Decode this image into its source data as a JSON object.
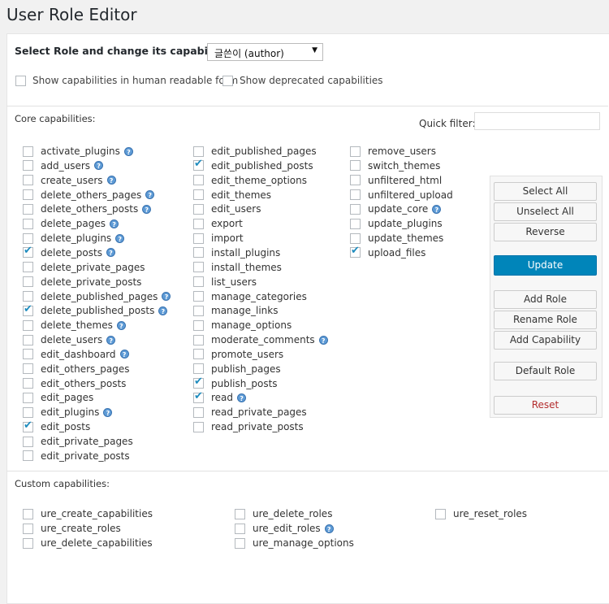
{
  "page_title": "User Role Editor",
  "role_label": "Select Role and change its capabilities:",
  "role_selected": "글쓴이 (author)",
  "options": {
    "human_readable": "Show capabilities in human readable form",
    "deprecated": "Show deprecated capabilities"
  },
  "core_label": "Core capabilities:",
  "quick_filter_label": "Quick filter:",
  "core_caps": [
    {
      "name": "activate_plugins",
      "checked": false,
      "help": true
    },
    {
      "name": "add_users",
      "checked": false,
      "help": true
    },
    {
      "name": "create_users",
      "checked": false,
      "help": true
    },
    {
      "name": "delete_others_pages",
      "checked": false,
      "help": true
    },
    {
      "name": "delete_others_posts",
      "checked": false,
      "help": true
    },
    {
      "name": "delete_pages",
      "checked": false,
      "help": true
    },
    {
      "name": "delete_plugins",
      "checked": false,
      "help": true
    },
    {
      "name": "delete_posts",
      "checked": true,
      "help": true
    },
    {
      "name": "delete_private_pages",
      "checked": false,
      "help": false
    },
    {
      "name": "delete_private_posts",
      "checked": false,
      "help": false
    },
    {
      "name": "delete_published_pages",
      "checked": false,
      "help": true
    },
    {
      "name": "delete_published_posts",
      "checked": true,
      "help": true
    },
    {
      "name": "delete_themes",
      "checked": false,
      "help": true
    },
    {
      "name": "delete_users",
      "checked": false,
      "help": true
    },
    {
      "name": "edit_dashboard",
      "checked": false,
      "help": true
    },
    {
      "name": "edit_others_pages",
      "checked": false,
      "help": false
    },
    {
      "name": "edit_others_posts",
      "checked": false,
      "help": false
    },
    {
      "name": "edit_pages",
      "checked": false,
      "help": false
    },
    {
      "name": "edit_plugins",
      "checked": false,
      "help": true
    },
    {
      "name": "edit_posts",
      "checked": true,
      "help": false
    },
    {
      "name": "edit_private_pages",
      "checked": false,
      "help": false
    },
    {
      "name": "edit_private_posts",
      "checked": false,
      "help": false
    },
    {
      "name": "edit_published_pages",
      "checked": false,
      "help": false
    },
    {
      "name": "edit_published_posts",
      "checked": true,
      "help": false
    },
    {
      "name": "edit_theme_options",
      "checked": false,
      "help": false
    },
    {
      "name": "edit_themes",
      "checked": false,
      "help": false
    },
    {
      "name": "edit_users",
      "checked": false,
      "help": false
    },
    {
      "name": "export",
      "checked": false,
      "help": false
    },
    {
      "name": "import",
      "checked": false,
      "help": false
    },
    {
      "name": "install_plugins",
      "checked": false,
      "help": false
    },
    {
      "name": "install_themes",
      "checked": false,
      "help": false
    },
    {
      "name": "list_users",
      "checked": false,
      "help": false
    },
    {
      "name": "manage_categories",
      "checked": false,
      "help": false
    },
    {
      "name": "manage_links",
      "checked": false,
      "help": false
    },
    {
      "name": "manage_options",
      "checked": false,
      "help": false
    },
    {
      "name": "moderate_comments",
      "checked": false,
      "help": true
    },
    {
      "name": "promote_users",
      "checked": false,
      "help": false
    },
    {
      "name": "publish_pages",
      "checked": false,
      "help": false
    },
    {
      "name": "publish_posts",
      "checked": true,
      "help": false
    },
    {
      "name": "read",
      "checked": true,
      "help": true
    },
    {
      "name": "read_private_pages",
      "checked": false,
      "help": false
    },
    {
      "name": "read_private_posts",
      "checked": false,
      "help": false
    },
    {
      "name": "remove_users",
      "checked": false,
      "help": false
    },
    {
      "name": "switch_themes",
      "checked": false,
      "help": false
    },
    {
      "name": "unfiltered_html",
      "checked": false,
      "help": false
    },
    {
      "name": "unfiltered_upload",
      "checked": false,
      "help": false
    },
    {
      "name": "update_core",
      "checked": false,
      "help": true
    },
    {
      "name": "update_plugins",
      "checked": false,
      "help": false
    },
    {
      "name": "update_themes",
      "checked": false,
      "help": false
    },
    {
      "name": "upload_files",
      "checked": true,
      "help": false
    }
  ],
  "buttons": {
    "select_all": "Select All",
    "unselect_all": "Unselect All",
    "reverse": "Reverse",
    "update": "Update",
    "add_role": "Add Role",
    "rename_role": "Rename Role",
    "add_capability": "Add Capability",
    "default_role": "Default Role",
    "reset": "Reset"
  },
  "custom_label": "Custom capabilities:",
  "custom_caps": [
    {
      "name": "ure_create_capabilities",
      "checked": false,
      "help": false
    },
    {
      "name": "ure_create_roles",
      "checked": false,
      "help": false
    },
    {
      "name": "ure_delete_capabilities",
      "checked": false,
      "help": false
    },
    {
      "name": "ure_delete_roles",
      "checked": false,
      "help": false
    },
    {
      "name": "ure_edit_roles",
      "checked": false,
      "help": true
    },
    {
      "name": "ure_manage_options",
      "checked": false,
      "help": false
    },
    {
      "name": "ure_reset_roles",
      "checked": false,
      "help": false
    }
  ],
  "colors": {
    "primary": "#0085ba",
    "accent": "#1e8cbe",
    "danger": "#b32d2e"
  }
}
